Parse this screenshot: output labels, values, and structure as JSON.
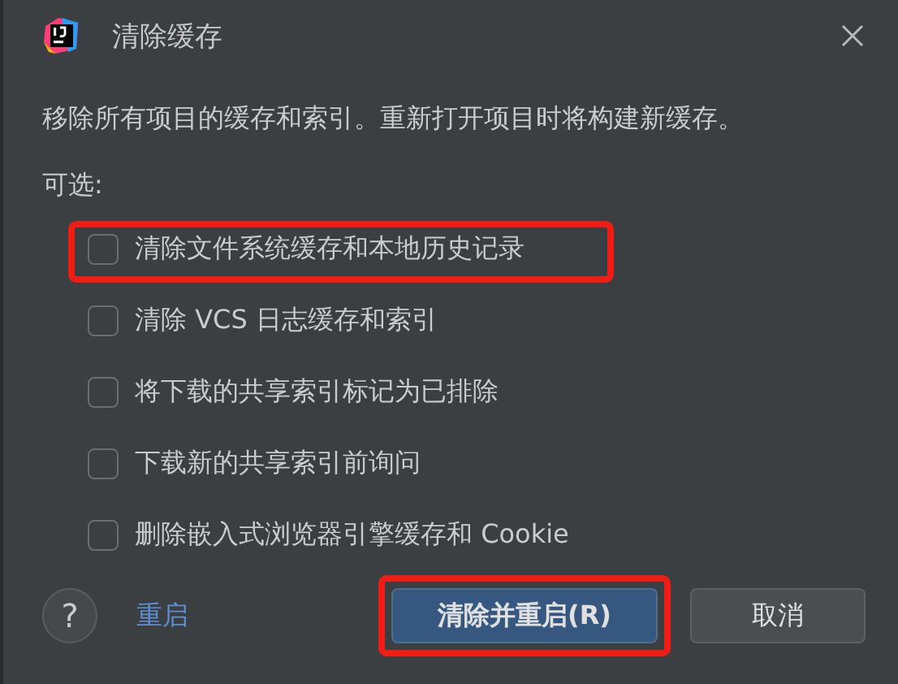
{
  "window": {
    "title": "清除缓存"
  },
  "description": "移除所有项目的缓存和索引。重新打开项目时将构建新缓存。",
  "options_label": "可选:",
  "options": [
    {
      "label": "清除文件系统缓存和本地历史记录",
      "checked": false,
      "highlighted": true
    },
    {
      "label": "清除 VCS 日志缓存和索引",
      "checked": false,
      "highlighted": false
    },
    {
      "label": "将下载的共享索引标记为已排除",
      "checked": false,
      "highlighted": false
    },
    {
      "label": "下载新的共享索引前询问",
      "checked": false,
      "highlighted": false
    },
    {
      "label": "删除嵌入式浏览器引擎缓存和 Cookie",
      "checked": false,
      "highlighted": false
    }
  ],
  "footer": {
    "help": "?",
    "link": "重启",
    "buttons": [
      {
        "label": "清除并重启(R)",
        "kind": "primary",
        "highlighted": true
      },
      {
        "label": "取消",
        "kind": "secondary",
        "highlighted": false
      }
    ]
  }
}
